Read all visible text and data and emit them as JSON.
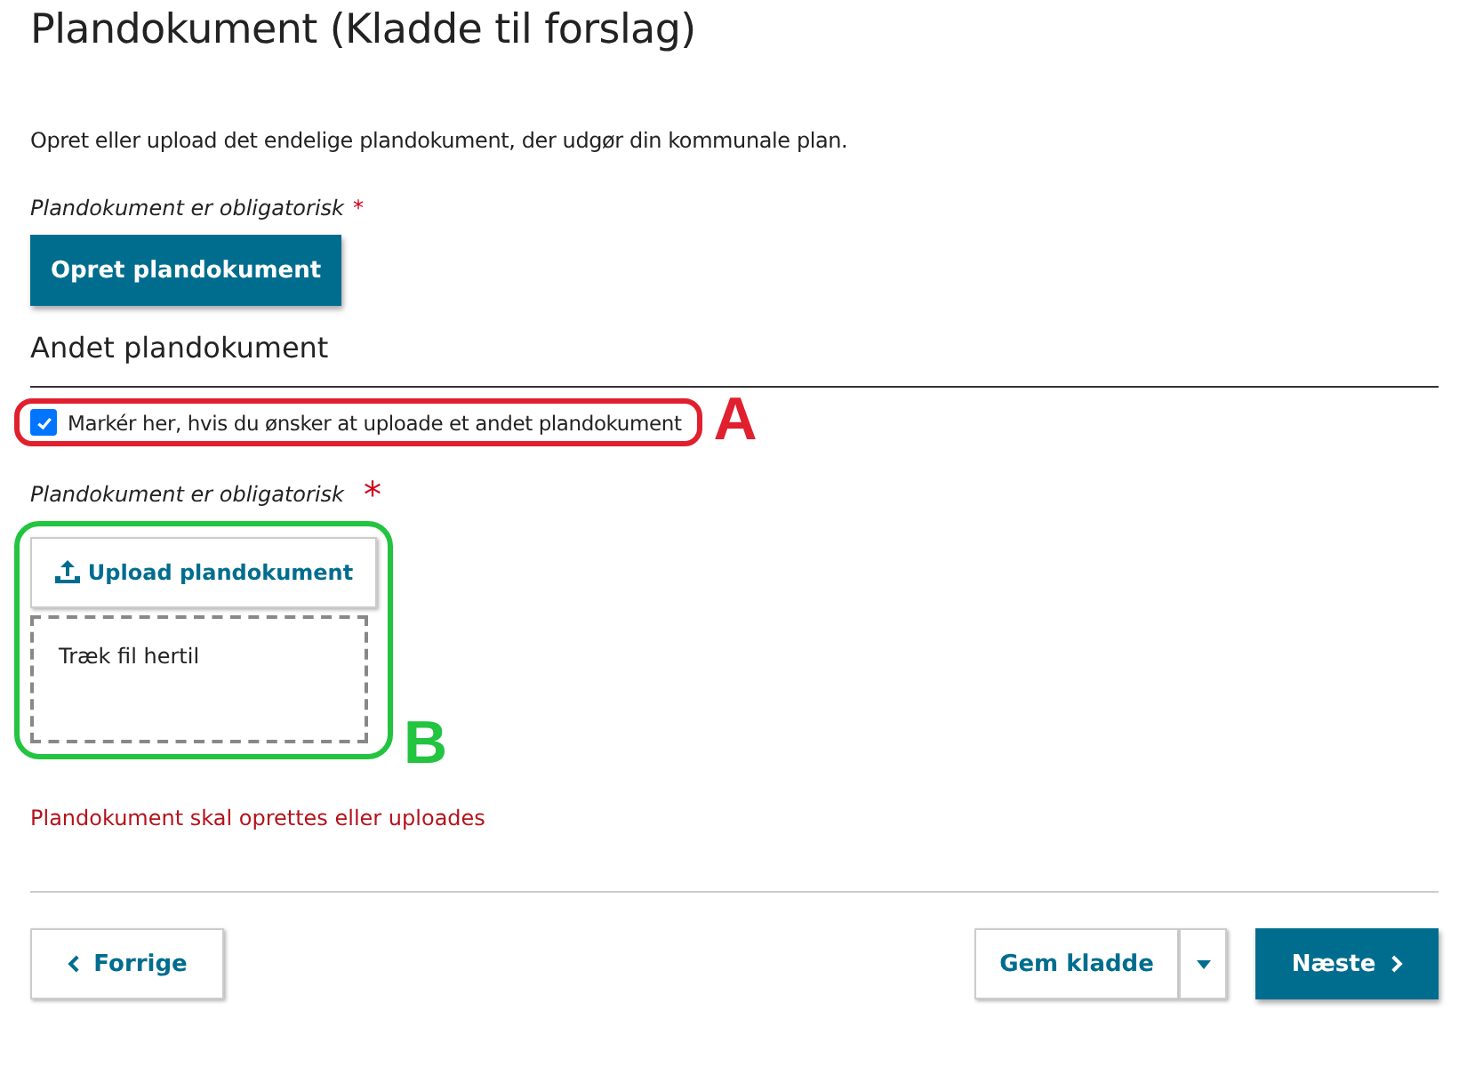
{
  "title": "Plandokument (Kladde til forslag)",
  "description": "Opret eller upload det endelige plandokument, der udgør din kommunale plan.",
  "primary": {
    "label": "Plandokument er obligatorisk",
    "required_mark": "*",
    "button": "Opret plandokument"
  },
  "other": {
    "heading": "Andet plandokument",
    "checkbox": {
      "label": "Markér her, hvis du ønsker at uploade et andet plandokument",
      "checked": true
    },
    "annotation_a": {
      "letter": "A",
      "color": "#e0202e"
    },
    "label": "Plandokument er obligatorisk",
    "required_mark": "*",
    "upload_button": "Upload plandokument",
    "dropzone": "Træk fil hertil",
    "annotation_b": {
      "letter": "B",
      "color": "#22c440"
    },
    "error": "Plandokument skal oprettes eller uploades"
  },
  "footer": {
    "back": "Forrige",
    "save": "Gem kladde",
    "next": "Næste"
  }
}
